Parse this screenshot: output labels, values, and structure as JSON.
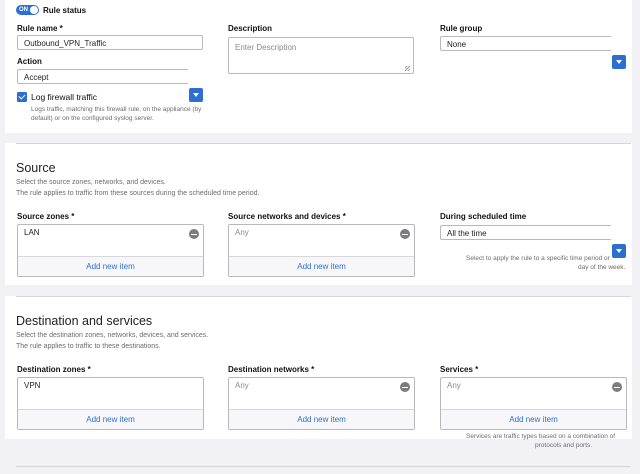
{
  "rule_status": {
    "toggle_text": "ON",
    "label": "Rule status"
  },
  "rule_name": {
    "label": "Rule name *",
    "value": "Outbound_VPN_Traffic"
  },
  "description": {
    "label": "Description",
    "placeholder": "Enter Description"
  },
  "rule_group": {
    "label": "Rule group",
    "value": "None"
  },
  "action": {
    "label": "Action",
    "value": "Accept"
  },
  "log": {
    "label": "Log firewall traffic",
    "help": [
      "Logs traffic, matching this firewall rule, on the appliance (by",
      "default) or on the configured syslog server."
    ],
    "checked": true
  },
  "source": {
    "title": "Source",
    "desc": [
      "Select the source zones, networks, and devices.",
      "The rule applies to traffic from these sources during the scheduled time period."
    ],
    "zones": {
      "label": "Source zones *",
      "item": "LAN",
      "add": "Add new item"
    },
    "networks": {
      "label": "Source networks and devices *",
      "item": "Any",
      "add": "Add new item"
    },
    "schedule": {
      "label": "During scheduled time",
      "value": "All the time",
      "help": [
        "Select to apply the rule to a specific time period or",
        "day of the week."
      ]
    }
  },
  "destination": {
    "title": "Destination and services",
    "desc": [
      "Select the destination zones, networks, devices, and services.",
      "The rule applies to traffic to these destinations."
    ],
    "zones": {
      "label": "Destination zones *",
      "item": "VPN",
      "add": "Add new item"
    },
    "networks": {
      "label": "Destination networks *",
      "item": "Any",
      "add": "Add new item"
    },
    "services": {
      "label": "Services *",
      "item": "Any",
      "add": "Add new item",
      "help": [
        "Services are traffic types based on a combination of",
        "protocols and ports."
      ]
    }
  },
  "colors": {
    "accent": "#2d6fd0",
    "background": "#f2f2f4"
  }
}
